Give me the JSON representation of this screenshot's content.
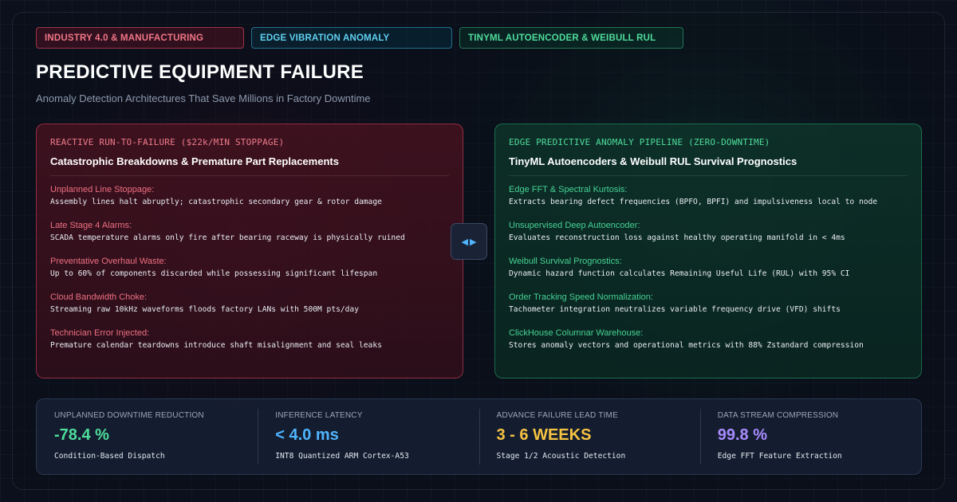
{
  "tags": [
    {
      "label": "INDUSTRY 4.0 & MANUFACTURING",
      "color": "#f07686"
    },
    {
      "label": "EDGE VIBRATION ANOMALY",
      "color": "#5fd0f0"
    },
    {
      "label": "TINYML AUTOENCODER & WEIBULL RUL",
      "color": "#4fdc9c"
    }
  ],
  "header": {
    "title": "PREDICTIVE EQUIPMENT FAILURE",
    "subtitle": "Anomaly Detection Architectures That Save Millions in Factory Downtime"
  },
  "left_panel": {
    "kicker": "REACTIVE RUN-TO-FAILURE ($22k/MIN STOPPAGE)",
    "heading": "Catastrophic Breakdowns & Premature Part Replacements",
    "items": [
      {
        "label": "Unplanned Line Stoppage:",
        "desc": "Assembly lines halt abruptly; catastrophic secondary gear & rotor damage"
      },
      {
        "label": "Late Stage 4 Alarms:",
        "desc": "SCADA temperature alarms only fire after bearing raceway is physically ruined"
      },
      {
        "label": "Preventative Overhaul Waste:",
        "desc": "Up to 60% of components discarded while possessing significant lifespan"
      },
      {
        "label": "Cloud Bandwidth Choke:",
        "desc": "Streaming raw 10kHz waveforms floods factory LANs with 500M pts/day"
      },
      {
        "label": "Technician Error Injected:",
        "desc": "Premature calendar teardowns introduce shaft misalignment and seal leaks"
      }
    ]
  },
  "right_panel": {
    "kicker": "EDGE PREDICTIVE ANOMALY PIPELINE (ZERO-DOWNTIME)",
    "heading": "TinyML Autoencoders & Weibull RUL Survival Prognostics",
    "items": [
      {
        "label": "Edge FFT & Spectral Kurtosis:",
        "desc": "Extracts bearing defect frequencies (BPFO, BPFI) and impulsiveness local to node"
      },
      {
        "label": "Unsupervised Deep Autoencoder:",
        "desc": "Evaluates reconstruction loss against healthy operating manifold in < 4ms"
      },
      {
        "label": "Weibull Survival Prognostics:",
        "desc": "Dynamic hazard function calculates Remaining Useful Life (RUL) with 95% CI"
      },
      {
        "label": "Order Tracking Speed Normalization:",
        "desc": "Tachometer integration neutralizes variable frequency drive (VFD) shifts"
      },
      {
        "label": "ClickHouse Columnar Warehouse:",
        "desc": "Stores anomaly vectors and operational metrics with 88% Zstandard compression"
      }
    ]
  },
  "swap_icon": "left-right-arrows-icon",
  "stats": [
    {
      "label": "UNPLANNED DOWNTIME REDUCTION",
      "value": "-78.4 %",
      "note": "Condition-Based Dispatch",
      "color": "#4fdc9c"
    },
    {
      "label": "INFERENCE LATENCY",
      "value": "< 4.0 ms",
      "note": "INT8 Quantized ARM Cortex-A53",
      "color": "#4fb4ff"
    },
    {
      "label": "ADVANCE FAILURE LEAD TIME",
      "value": "3 - 6 WEEKS",
      "note": "Stage 1/2 Acoustic Detection",
      "color": "#f6c342"
    },
    {
      "label": "DATA STREAM COMPRESSION",
      "value": "99.8 %",
      "note": "Edge FFT Feature Extraction",
      "color": "#a88cff"
    }
  ]
}
